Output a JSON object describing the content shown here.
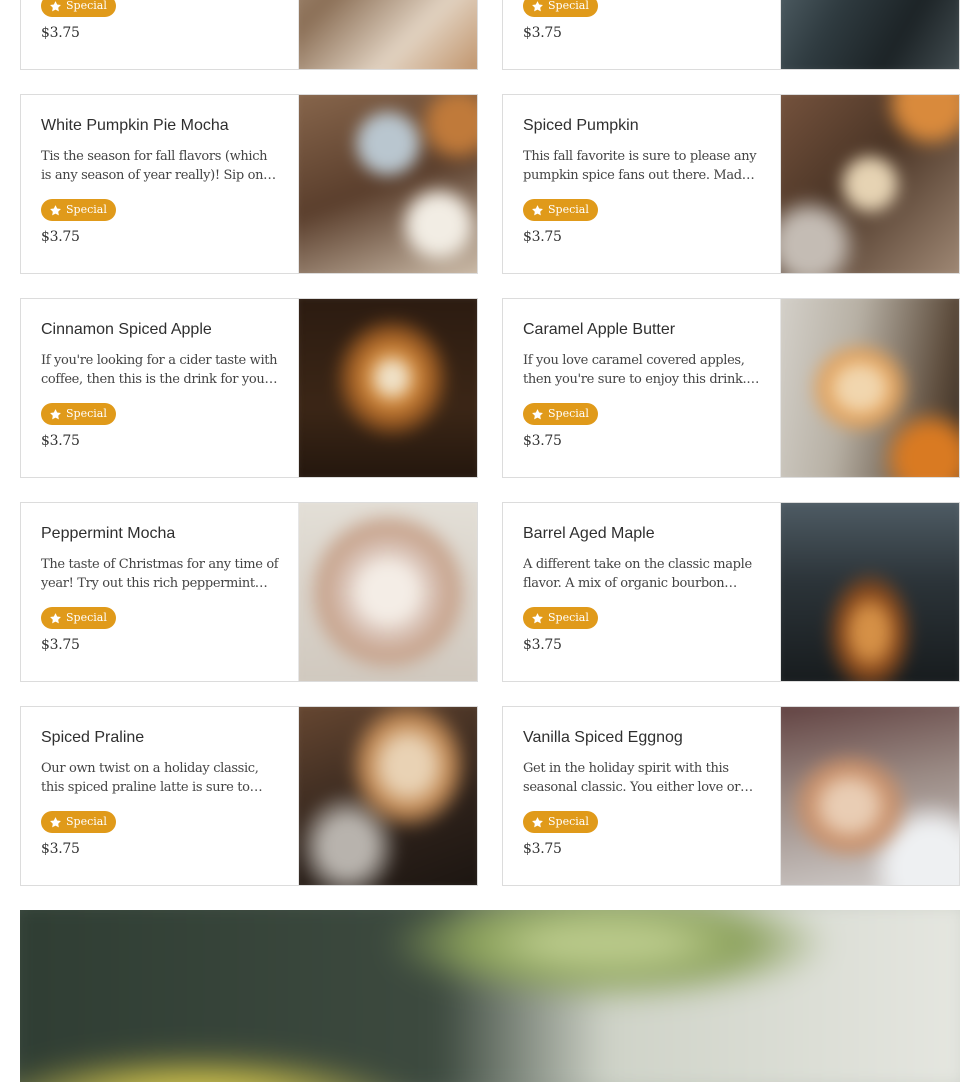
{
  "badge_label": "Special",
  "colors": {
    "badge": "#e09a1a",
    "border": "#dcdcdc",
    "text": "#333333"
  },
  "top_row": [
    {
      "price": "$3.75",
      "icon": "star-icon"
    },
    {
      "price": "$3.75",
      "icon": "star-icon"
    }
  ],
  "items": [
    {
      "title": "White Pumpkin Pie Mocha",
      "description": "Tis the season for fall flavors (which is any season of year really)! Sip on this white pumpkin pie mocha",
      "badge": "Special",
      "price": "$3.75"
    },
    {
      "title": "Spiced Pumpkin",
      "description": "This fall favorite is sure to please any pumpkin spice fans out there. Made with real pumpkin",
      "badge": "Special",
      "price": "$3.75"
    },
    {
      "title": "Cinnamon Spiced Apple",
      "description": "If you're looking for a cider taste with coffee, then this is the drink for you. Warm spices",
      "badge": "Special",
      "price": "$3.75"
    },
    {
      "title": "Caramel Apple Butter",
      "description": "If you love caramel covered apples, then you're sure to enjoy this drink. Sweet and buttery",
      "badge": "Special",
      "price": "$3.75"
    },
    {
      "title": "Peppermint Mocha",
      "description": "The taste of Christmas for any time of year! Try out this rich peppermint mocha today",
      "badge": "Special",
      "price": "$3.75"
    },
    {
      "title": "Barrel Aged Maple",
      "description": "A different take on the classic maple flavor. A mix of organic bourbon barrel aged maple",
      "badge": "Special",
      "price": "$3.75"
    },
    {
      "title": "Spiced Praline",
      "description": "Our own twist on a holiday classic, this spiced praline latte is sure to warm you up",
      "badge": "Special",
      "price": "$3.75"
    },
    {
      "title": "Vanilla Spiced Eggnog",
      "description": "Get in the holiday spirit with this seasonal classic. You either love or hate eggnog",
      "badge": "Special",
      "price": "$3.75"
    }
  ]
}
